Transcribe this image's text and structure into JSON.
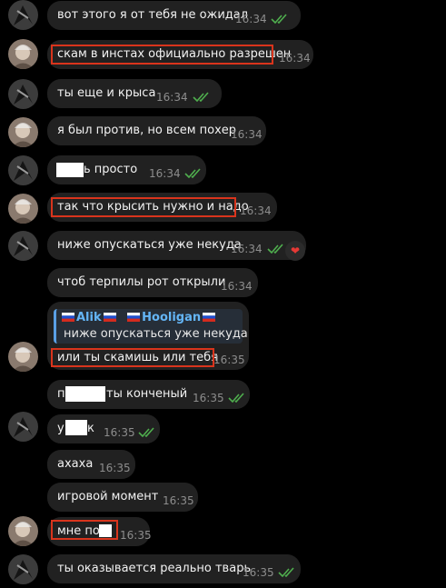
{
  "colors": {
    "background": "#000000",
    "bubble": "#212121",
    "highlight": "#d9341c",
    "read_check": "#4fae4e",
    "reply_accent": "#64b5f6"
  },
  "messages": [
    {
      "text": "вот этого я от тебя не ожидал",
      "time": "16:34",
      "sender": "friend",
      "read": true,
      "highlighted": false
    },
    {
      "text": "скам в инстах официально разрешен",
      "time": "16:34",
      "sender": "user",
      "read": false,
      "highlighted": true
    },
    {
      "text": "ты еще и крыса",
      "time": "16:34",
      "sender": "friend",
      "read": true,
      "highlighted": false
    },
    {
      "text": "я был против, но всем похер",
      "time": "16:34",
      "sender": "user",
      "read": false,
      "highlighted": false
    },
    {
      "text": "ь просто",
      "time": "16:34",
      "sender": "friend",
      "read": true,
      "highlighted": false,
      "redacted": true
    },
    {
      "text": "так что крысить нужно и надо",
      "time": "16:34",
      "sender": "user",
      "read": false,
      "highlighted": true
    },
    {
      "text": "ниже опускаться уже некуда",
      "time": "16:34",
      "sender": "friend",
      "read": true,
      "highlighted": false,
      "reaction": "heart-icon"
    },
    {
      "text": "чтоб терпилы рот открыли",
      "time": "16:34",
      "sender": "user",
      "read": false,
      "highlighted": false
    },
    {
      "text": "или ты скамишь или тебя",
      "time": "16:35",
      "sender": "user",
      "read": false,
      "highlighted": true,
      "reply": {
        "author": "Alik",
        "author_suffix": "Hooligan",
        "text": "ниже опускаться уже некуда"
      }
    },
    {
      "text": "п",
      "text_after": "ты конченый",
      "time": "16:35",
      "sender": "friend",
      "read": true,
      "highlighted": false,
      "redacted": true
    },
    {
      "text": "у",
      "text_after": "к",
      "time": "16:35",
      "sender": "friend",
      "read": true,
      "highlighted": false,
      "redacted": true
    },
    {
      "text": "ахаха",
      "time": "16:35",
      "sender": "user",
      "read": false,
      "highlighted": false
    },
    {
      "text": "игровой момент",
      "time": "16:35",
      "sender": "user",
      "read": false,
      "highlighted": false
    },
    {
      "text": "мне по",
      "time": "16:35",
      "sender": "user",
      "read": false,
      "highlighted": true,
      "redacted": true
    },
    {
      "text": "ты оказывается реально тварь",
      "time": "16:35",
      "sender": "friend",
      "read": true,
      "highlighted": false
    }
  ]
}
